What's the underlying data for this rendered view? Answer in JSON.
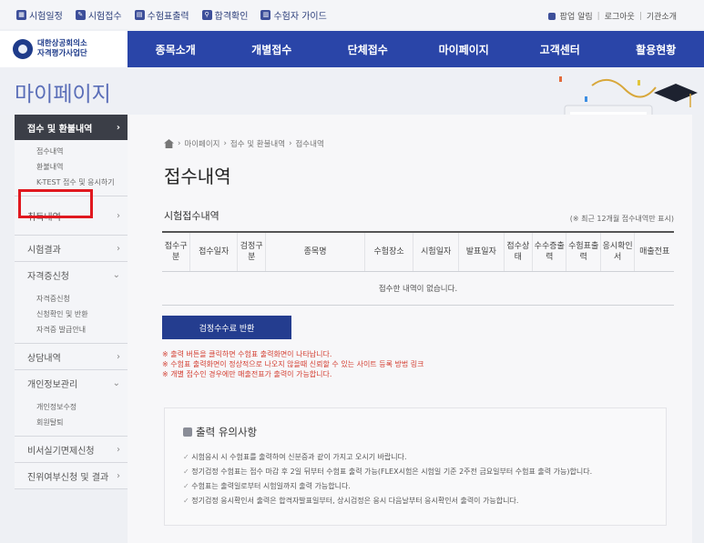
{
  "top_links": [
    {
      "label": "시험일정",
      "icon": "calendar-icon"
    },
    {
      "label": "시험접수",
      "icon": "edit-icon"
    },
    {
      "label": "수험표출력",
      "icon": "printer-icon"
    },
    {
      "label": "합격확인",
      "icon": "search-icon"
    },
    {
      "label": "수험자 가이드",
      "icon": "book-icon"
    }
  ],
  "top_right": {
    "popup": "팝업 알림",
    "logout": "로그아웃",
    "agency_intro": "기관소개"
  },
  "logo": {
    "line1": "대한상공회의소",
    "line2": "자격평가사업단"
  },
  "gnb": [
    "종목소개",
    "개별접수",
    "단체접수",
    "마이페이지",
    "고객센터",
    "활용현황"
  ],
  "page_title": "마이페이지",
  "sidebar": {
    "sections": [
      {
        "label": "접수 및 환불내역",
        "active": true,
        "items": [
          "접수내역",
          "환불내역",
          "K-TEST 접수 및 응시하기"
        ]
      },
      {
        "label": "취득내역",
        "active": false,
        "items": []
      },
      {
        "label": "시험결과",
        "active": false,
        "items": []
      },
      {
        "label": "자격증신청",
        "active": false,
        "items": [
          "자격증신청",
          "신청확인 및 반환",
          "자격증 발급안내"
        ]
      },
      {
        "label": "상담내역",
        "active": false,
        "items": []
      },
      {
        "label": "개인정보관리",
        "active": false,
        "items": [
          "개인정보수정",
          "회원탈퇴"
        ]
      },
      {
        "label": "비서실기면제신청",
        "active": false,
        "items": []
      },
      {
        "label": "진위여부신청 및 결과",
        "active": false,
        "items": []
      }
    ]
  },
  "breadcrumb": [
    "마이페이지",
    "접수 및 환불내역",
    "접수내역"
  ],
  "content_title": "접수내역",
  "table": {
    "title": "시험접수내역",
    "note": "(※ 최근 12개월 접수내역만 표시)",
    "headers": [
      "접수구분",
      "접수일자",
      "검정구분",
      "종목명",
      "수험장소",
      "시험일자",
      "발표일자",
      "접수상태",
      "수수증출력",
      "수험표출력",
      "응시확인서",
      "매출전표"
    ],
    "empty_message": "접수한 내역이 없습니다."
  },
  "fee_button": "검정수수료 반환",
  "notes": [
    "※ 출력 버튼을 클릭하면 수험표 출력화면이 나타납니다.",
    "※ 수험표 출력화면이 정상적으로 나오지 않을때 신뢰할 수 있는 사이트 등록 방법 링크",
    "※ 개별 접수인 경우에만 매출전표가 출력이 가능합니다."
  ],
  "caution": {
    "title": "출력 유의사항",
    "items": [
      "시험응시 시 수험표를 출력하여 신분증과 같이 가지고 오시기 바랍니다.",
      "정기검정 수험표는 접수 마감 후 2일 뒤부터 수험표 출력 가능(FLEX시험은 시험일 기준 2주전 금요일부터 수험표 출력 가능)합니다.",
      "수험표는 출력일로부터 시험일까지 출력 가능합니다.",
      "정기검정 응시확인서 출력은 합격자발표일부터, 상시검정은 응시 다음날부터 응시확인서 출력이 가능합니다."
    ]
  },
  "colors": {
    "nav": "#2a45a8",
    "title_accent": "#5a6eb8",
    "button": "#243d8f",
    "notice_red": "#d33c2f",
    "highlight": "#e0181f"
  }
}
